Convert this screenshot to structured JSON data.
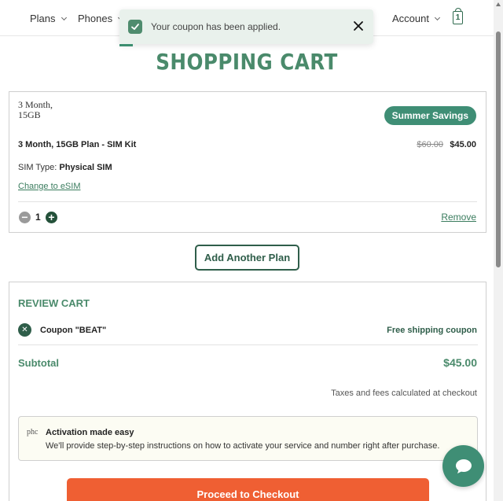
{
  "nav": {
    "items": [
      "Plans",
      "Phones",
      "Account"
    ],
    "cart_count": "1"
  },
  "toast": {
    "message": "Your coupon has been applied."
  },
  "page": {
    "title": "SHOPPING CART"
  },
  "cart_item": {
    "image_alt": "3 Month, 15GB",
    "badge": "Summer Savings",
    "name": "3 Month, 15GB Plan - SIM Kit",
    "price_original": "$60.00",
    "price_current": "$45.00",
    "sim_type_label": "SIM Type:",
    "sim_type_value": "Physical SIM",
    "change_link": "Change to eSIM",
    "quantity": "1",
    "remove_label": "Remove"
  },
  "add_plan_label": "Add Another Plan",
  "review": {
    "title": "REVIEW CART",
    "coupon_name": "Coupon \"BEAT\"",
    "coupon_desc": "Free shipping coupon",
    "subtotal_label": "Subtotal",
    "subtotal_value": "$45.00",
    "tax_note": "Taxes and fees calculated at checkout",
    "activation_img_alt": "phc",
    "activation_title": "Activation made easy",
    "activation_body": "We'll provide step-by-step instructions on how to activate your service and number right after purchase.",
    "checkout_label": "Proceed to Checkout"
  },
  "colors": {
    "brand_green": "#4a8a6b",
    "dark_green": "#2f5e4a",
    "badge_green": "#3f8e75",
    "checkout_orange": "#ef5f33"
  },
  "icons": {
    "toast": "check-icon",
    "close": "close-icon",
    "cart": "shopping-bag-icon",
    "chat": "chat-bubble-icon"
  }
}
